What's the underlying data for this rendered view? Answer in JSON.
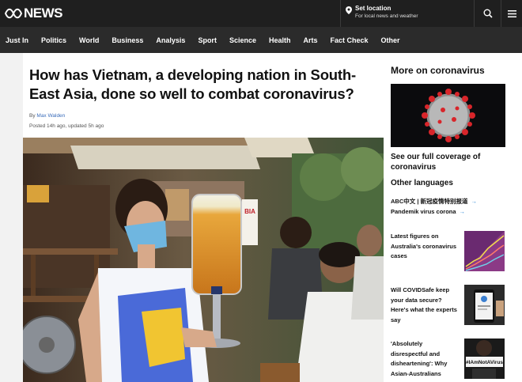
{
  "header": {
    "logo_text": "NEWS",
    "location_title": "Set location",
    "location_sub": "For local news and weather"
  },
  "nav": {
    "items": [
      "Just In",
      "Politics",
      "World",
      "Business",
      "Analysis",
      "Sport",
      "Science",
      "Health",
      "Arts",
      "Fact Check",
      "Other"
    ]
  },
  "article": {
    "headline": "How has Vietnam, a developing nation in South-East Asia, done so well to combat coronavirus?",
    "by_prefix": "By",
    "author": "Max Walden",
    "posted": "Posted 14h ago, updated 5h ago",
    "hero_sign": "BIA"
  },
  "sidebar": {
    "title": "More on coronavirus",
    "coverage_link": "See our full coverage of coronavirus",
    "other_languages_title": "Other languages",
    "languages": [
      {
        "label": "ABC中文 | 新冠疫情特别报道"
      },
      {
        "label": "Pandemik virus corona"
      }
    ],
    "stories": [
      {
        "title": "Latest figures on Australia's coronavirus cases"
      },
      {
        "title": "Will COVIDSafe keep your data secure? Here's what the experts say"
      },
      {
        "title": "'Absolutely disrespectful and disheartening': Why Asian-Australians"
      }
    ],
    "hashtag_text": "#IAmNotAVirus"
  },
  "colors": {
    "header_bg": "#1f1f1f",
    "nav_bg": "#2b2b2b",
    "link_blue": "#3b6dbb",
    "arrow_blue": "#2a86d6"
  }
}
